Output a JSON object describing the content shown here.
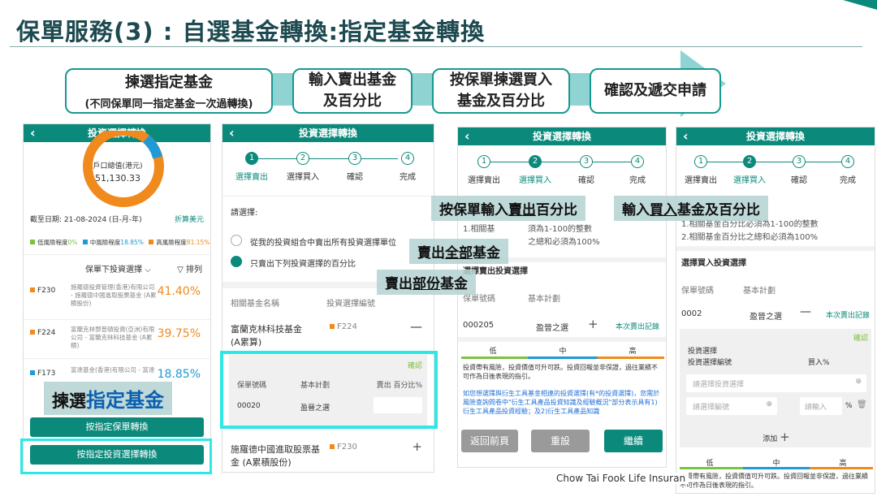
{
  "title": "保單服務(3) : 自選基金轉換:指定基金轉換",
  "flow": {
    "steps": [
      {
        "label": "揀選指定基金",
        "sub": "(不同保單同一指定基金一次過轉換)"
      },
      {
        "label1": "輸入賣出基金",
        "label2": "及百分比"
      },
      {
        "label1": "按保單揀選買入",
        "label2": "基金及百分比"
      },
      {
        "label": "確認及遞交申請"
      }
    ]
  },
  "phone_header": "投資選擇轉換",
  "screen1": {
    "donut_label": "戶口總值(港元)",
    "donut_value": "51,130.33",
    "as_of": "截至日期: 21-08-2024 (日-月-年)",
    "convert_link": "折算美元",
    "risk_legend": [
      {
        "name": "低風險程度",
        "pct": "0%",
        "color": "#7cc242"
      },
      {
        "name": "中風險程度",
        "pct": "18.85%",
        "color": "#1f9ad6"
      },
      {
        "name": "高風險程度",
        "pct": "81.15%",
        "color": "#f08a1c"
      }
    ],
    "sort_label": "保單下投資選擇",
    "sort_button": "排列",
    "funds": [
      {
        "code": "F230",
        "name": "施羅德投資管理(香港)有限公司 - 施羅德中國進取股票基金 (A累積股份)",
        "pct": "41.40%"
      },
      {
        "code": "F224",
        "name": "富蘭克林鄧普頓投資(亞洲)有限公司 - 富蘭克林科技基金 (A累積)",
        "pct": "39.75%"
      },
      {
        "code": "F173",
        "name": "富達基金(香港)有限公司 - 富達",
        "pct": "18.85%"
      }
    ],
    "btn_policy": "按指定保單轉換",
    "btn_fund": "按指定投資選擇轉換"
  },
  "steps_labels": [
    "選擇賣出",
    "選擇買入",
    "確認",
    "完成"
  ],
  "screen2": {
    "prompt": "請選擇:",
    "option1": "從我的投資組合中賣出所有投資選擇單位",
    "option2": "只賣出下列投資選擇的百分比",
    "col1": "相關基金名稱",
    "col2": "投資選擇編號",
    "fund1_name": "富蘭克林科技基金 (A累算)",
    "fund1_code": "F224",
    "confirm": "確認",
    "col_policy": "保單號碼",
    "col_plan": "基本計劃",
    "col_sell": "賣出 百分比%",
    "row_policy": "00020",
    "row_plan": "盈晉之選",
    "fund2_name": "施羅德中國進取股票基金 (A累積股份)",
    "fund2_code": "F230"
  },
  "screen3": {
    "note1": "1.相關基",
    "note1b": "須為1-100的整數",
    "note2b": "之總和必須為100%",
    "sell_header": "選擇賣出投資選擇",
    "col_policy": "保單號碼",
    "col_plan": "基本計劃",
    "row_policy": "000205",
    "row_plan": "盈晉之選",
    "record_link": "本次賣出記錄",
    "risk": [
      "低",
      "中",
      "高"
    ],
    "disclaimer": "投資帶有風險，投資價值可升可跌。投資回報並非保證，過往業績不可作為日後表現的指引。",
    "notice": "如您想選擇與衍生工具基金相連的投資選擇(有*的投資選擇)，您需於風險查詢問卷中\"衍生工具產品投資知識及經驗概況\"部分表示具有1)衍生工具產品投資經驗；及2)衍生工具產品知識",
    "btn_back": "返回前頁",
    "btn_reset": "重設",
    "btn_next": "繼續"
  },
  "screen4": {
    "note1": "1.相關基金百分比必須為1-100的整數",
    "note2": "2.相關基金百分比之總和必須為100%",
    "buy_header": "選擇買入投資選擇",
    "col_policy": "保單號碼",
    "col_plan": "基本計劃",
    "row_policy": "0002",
    "row_plan": "盈晉之選",
    "record_link": "本次賣出記錄",
    "confirm": "確認",
    "inv_label": "投資選擇",
    "inv_code_label": "投資選擇編號",
    "buy_pct": "買入%",
    "select_ph": "請選擇投資選擇",
    "code_ph": "請選擇編號",
    "input_ph": "請輸入",
    "pct_sign": "%",
    "add": "添加",
    "risk": [
      "低",
      "中",
      "高"
    ],
    "disclaimer": "投資帶有風險，投資價值可升可跌。投資回報並非保證，過往業績不可作為日後表現的指引。"
  },
  "callouts": {
    "c1a": "按保單輸入",
    "c1b": "賣出",
    "c1c": "百分比",
    "c2a": "輸入",
    "c2b": "買入",
    "c2c": "基金及百分比",
    "c3a": "賣出",
    "c3b": "全部",
    "c3c": "基金",
    "c4a": "賣出",
    "c4b": "部份",
    "c4c": "基金",
    "c5a": "揀選",
    "c5b": "指定基金"
  },
  "footer": "Chow Tai Fook Life Insuran",
  "colors": {
    "teal": "#0b8a7c",
    "highlight": "#2ee8e8",
    "orange": "#f08a1c",
    "blue": "#1f9ad6"
  }
}
